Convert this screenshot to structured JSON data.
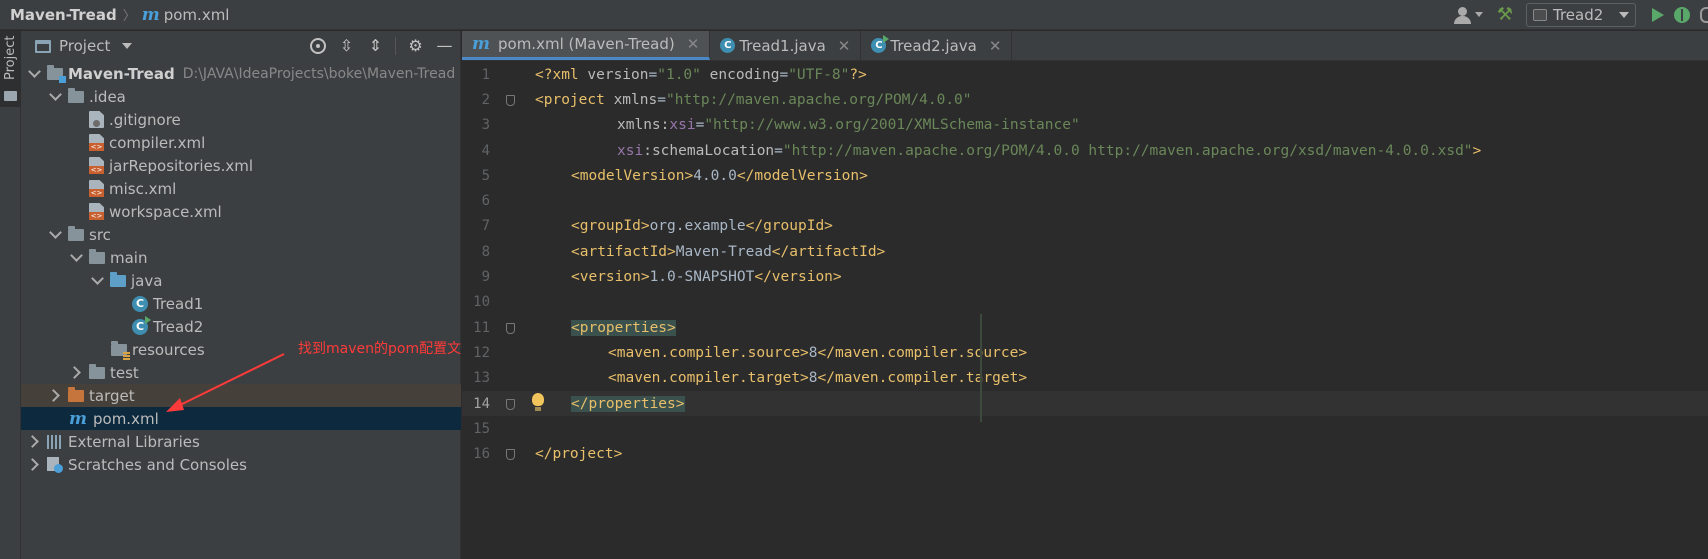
{
  "breadcrumb": {
    "project": "Maven-Tread",
    "file": "pom.xml"
  },
  "toolbar": {
    "run_config": "Tread2"
  },
  "left_strip": {
    "label": "Project"
  },
  "project_panel": {
    "title": "Project",
    "tree": [
      {
        "label": "Maven-Tread",
        "path": "D:\\JAVA\\IdeaProjects\\boke\\Maven-Tread"
      },
      {
        "label": ".idea"
      },
      {
        "label": ".gitignore"
      },
      {
        "label": "compiler.xml"
      },
      {
        "label": "jarRepositories.xml"
      },
      {
        "label": "misc.xml"
      },
      {
        "label": "workspace.xml"
      },
      {
        "label": "src"
      },
      {
        "label": "main"
      },
      {
        "label": "java"
      },
      {
        "label": "Tread1"
      },
      {
        "label": "Tread2"
      },
      {
        "label": "resources"
      },
      {
        "label": "test"
      },
      {
        "label": "target"
      },
      {
        "label": "pom.xml"
      },
      {
        "label": "External Libraries"
      },
      {
        "label": "Scratches and Consoles"
      }
    ]
  },
  "annotation": "找到maven的pom配置文件",
  "editor": {
    "tabs": [
      {
        "label": "pom.xml (Maven-Tread)"
      },
      {
        "label": "Tread1.java"
      },
      {
        "label": "Tread2.java"
      }
    ],
    "line_numbers": [
      "1",
      "2",
      "3",
      "4",
      "5",
      "6",
      "7",
      "8",
      "9",
      "10",
      "11",
      "12",
      "13",
      "14",
      "15",
      "16"
    ],
    "lines": [
      [
        "<?xml ",
        "version",
        "=",
        "\"1.0\"",
        " ",
        "encoding",
        "=",
        "\"UTF-8\"",
        "?>"
      ],
      [
        "<project ",
        "xmlns",
        "=",
        "\"http://maven.apache.org/POM/4.0.0\""
      ],
      [
        "xmlns",
        ":",
        "xsi",
        "=",
        "\"http://www.w3.org/2001/XMLSchema-instance\""
      ],
      [
        "xsi",
        ":",
        "schemaLocation",
        "=",
        "\"http://maven.apache.org/POM/4.0.0 http://maven.apache.org/xsd/maven-4.0.0.xsd\"",
        ">"
      ],
      [
        "<modelVersion>",
        "4.0.0",
        "</modelVersion>"
      ],
      [],
      [
        "<groupId>",
        "org.example",
        "</groupId>"
      ],
      [
        "<artifactId>",
        "Maven-Tread",
        "</artifactId>"
      ],
      [
        "<version>",
        "1.0-SNAPSHOT",
        "</version>"
      ],
      [],
      [
        "<properties>"
      ],
      [
        "<maven.compiler.source>",
        "8",
        "</maven.compiler.source>"
      ],
      [
        "<maven.compiler.target>",
        "8",
        "</maven.compiler.target>"
      ],
      [
        "</properties>"
      ],
      [],
      [
        "</project>"
      ]
    ]
  },
  "colors": {
    "tag": "#e8bf6a",
    "string": "#6a8759",
    "namespace": "#9876aa",
    "text": "#a9b7c6",
    "annotation": "#ff3a3a",
    "selection": "#0d293e"
  }
}
